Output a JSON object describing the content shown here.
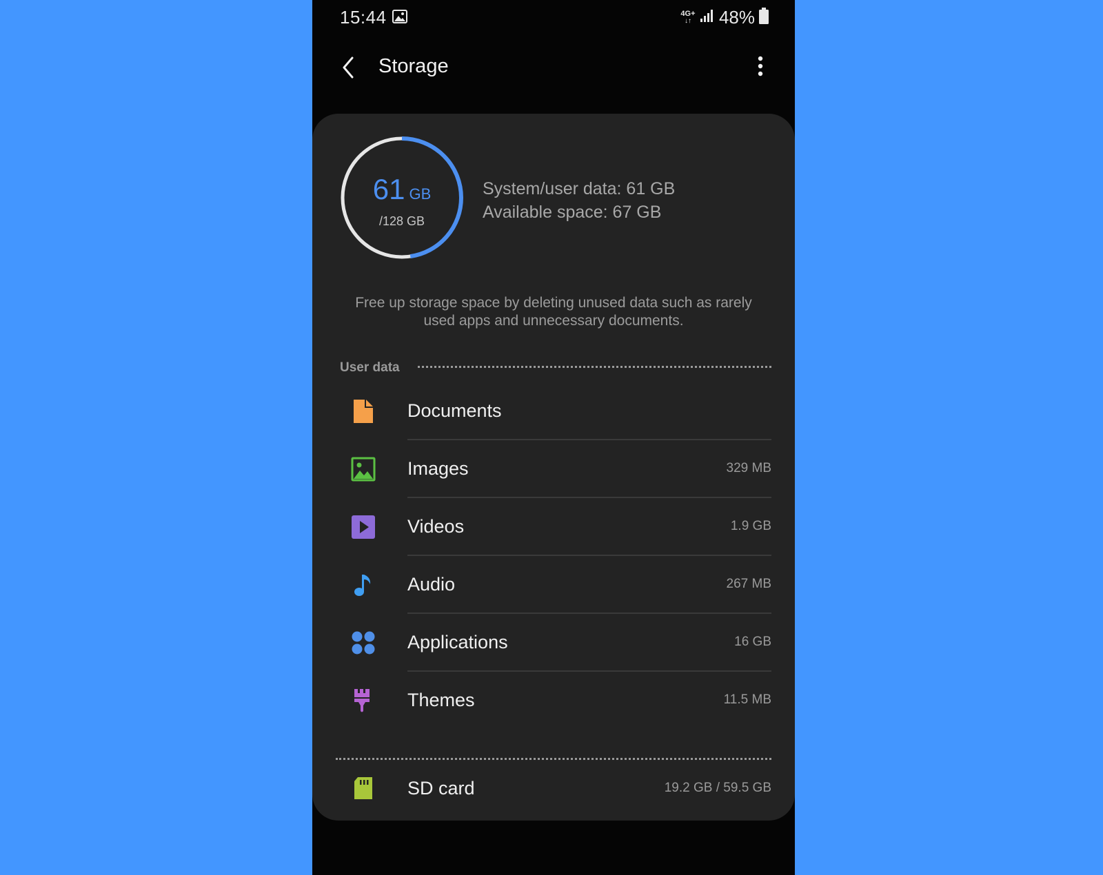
{
  "status_bar": {
    "time": "15:44",
    "network": "4G+",
    "battery": "48%"
  },
  "app_bar": {
    "title": "Storage"
  },
  "storage": {
    "used_value": "61",
    "used_unit": "GB",
    "total": "/128 GB",
    "used_fraction": 0.477,
    "system_user_data": "System/user data: 61 GB",
    "available_space": "Available space: 67 GB",
    "hint": "Free up storage space by deleting unused data such as rarely used apps and unnecessary documents."
  },
  "user_data": {
    "title": "User data",
    "items": [
      {
        "label": "Documents",
        "size": "",
        "icon": "document-icon",
        "color": "#f5a04a"
      },
      {
        "label": "Images",
        "size": "329 MB",
        "icon": "image-icon",
        "color": "#5bc043"
      },
      {
        "label": "Videos",
        "size": "1.9 GB",
        "icon": "video-icon",
        "color": "#8d6bd8"
      },
      {
        "label": "Audio",
        "size": "267 MB",
        "icon": "music-note-icon",
        "color": "#3f9ef2"
      },
      {
        "label": "Applications",
        "size": "16 GB",
        "icon": "apps-icon",
        "color": "#4f8fe8"
      },
      {
        "label": "Themes",
        "size": "11.5 MB",
        "icon": "brush-icon",
        "color": "#b563d3"
      }
    ]
  },
  "sd_card": {
    "label": "SD card",
    "size": "19.2 GB / 59.5 GB",
    "icon": "sd-card-icon",
    "color": "#a8c73a"
  },
  "colors": {
    "accent": "#4c8ff0",
    "ring_track": "#e6e6e6",
    "background": "#4396ff",
    "card": "#232323"
  }
}
